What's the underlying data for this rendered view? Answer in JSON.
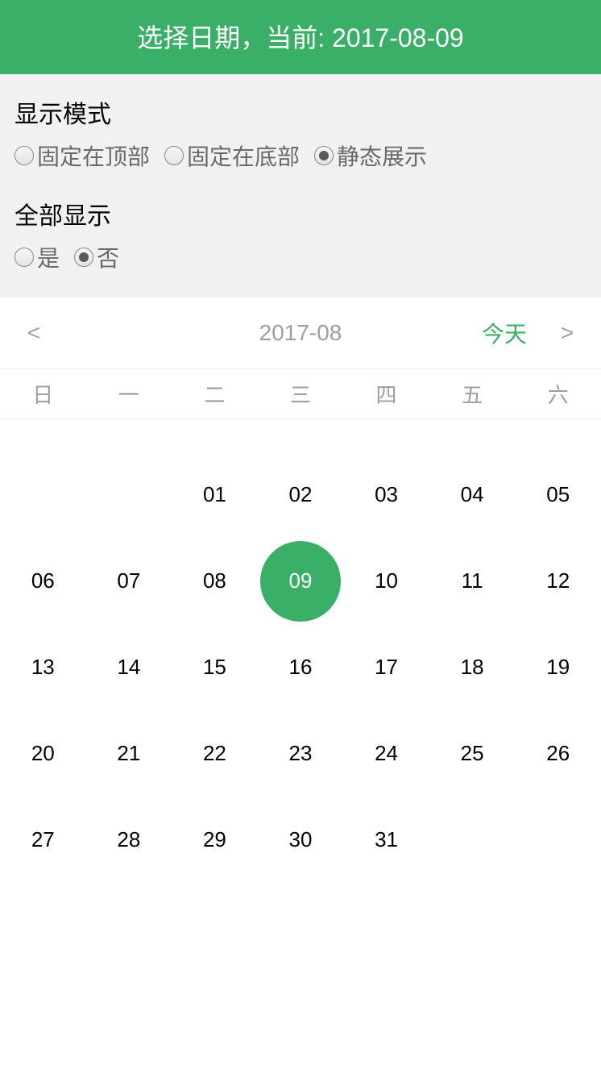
{
  "header": {
    "title": "选择日期，当前: 2017-08-09"
  },
  "options": {
    "displayMode": {
      "title": "显示模式",
      "items": [
        {
          "label": "固定在顶部",
          "checked": false
        },
        {
          "label": "固定在底部",
          "checked": false
        },
        {
          "label": "静态展示",
          "checked": true
        }
      ]
    },
    "showAll": {
      "title": "全部显示",
      "items": [
        {
          "label": "是",
          "checked": false
        },
        {
          "label": "否",
          "checked": true
        }
      ]
    }
  },
  "calendar": {
    "prev": "<",
    "next": ">",
    "month": "2017-08",
    "today": "今天",
    "weekdays": [
      "日",
      "一",
      "二",
      "三",
      "四",
      "五",
      "六"
    ],
    "leadingEmpty": 2,
    "days": [
      "01",
      "02",
      "03",
      "04",
      "05",
      "06",
      "07",
      "08",
      "09",
      "10",
      "11",
      "12",
      "13",
      "14",
      "15",
      "16",
      "17",
      "18",
      "19",
      "20",
      "21",
      "22",
      "23",
      "24",
      "25",
      "26",
      "27",
      "28",
      "29",
      "30",
      "31"
    ],
    "selected": "09"
  }
}
